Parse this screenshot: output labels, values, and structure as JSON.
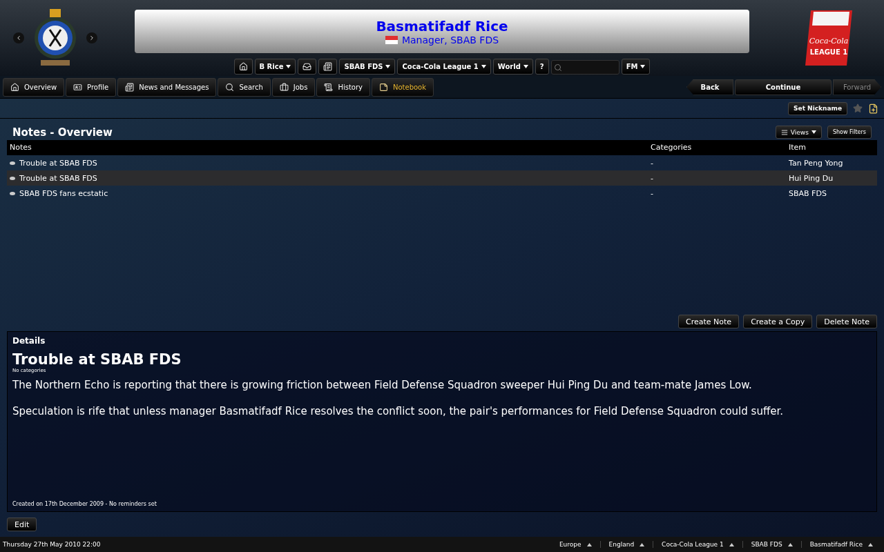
{
  "header": {
    "title": "Basmatifadf Rice",
    "subtitle": "Manager, SBAB FDS",
    "league_logo": [
      "Coca-Cola",
      "LEAGUE 1"
    ]
  },
  "toolbar": [
    {
      "kind": "home"
    },
    {
      "kind": "dropdown",
      "label": "B Rice"
    },
    {
      "kind": "inbox"
    },
    {
      "kind": "news"
    },
    {
      "kind": "dropdown",
      "label": "SBAB FDS"
    },
    {
      "kind": "dropdown",
      "label": "Coca-Cola League 1"
    },
    {
      "kind": "dropdown",
      "label": "World"
    },
    {
      "kind": "text",
      "label": "?"
    },
    {
      "kind": "search"
    },
    {
      "kind": "dropdown",
      "label": "FM"
    }
  ],
  "tabs": [
    {
      "label": "Overview",
      "selected": false
    },
    {
      "label": "Profile",
      "selected": false
    },
    {
      "label": "News and Messages",
      "selected": false
    },
    {
      "label": "Search",
      "selected": false
    },
    {
      "label": "Jobs",
      "selected": false
    },
    {
      "label": "History",
      "selected": false
    },
    {
      "label": "Notebook",
      "selected": true
    }
  ],
  "navigation": {
    "back": "Back",
    "continue": "Continue",
    "forward": "Forward",
    "forward_disabled": true
  },
  "nickname_button": "Set Nickname",
  "page_title": "Notes - Overview",
  "views_button": "Views",
  "filters_button": "Show Filters",
  "table": {
    "columns": [
      "Notes",
      "Categories",
      "Item"
    ],
    "rows": [
      {
        "note": "Trouble at SBAB FDS",
        "categories": "-",
        "item": "Tan Peng Yong",
        "selected": false
      },
      {
        "note": "Trouble at SBAB FDS",
        "categories": "-",
        "item": "Hui Ping Du",
        "selected": true
      },
      {
        "note": "SBAB FDS fans ecstatic",
        "categories": "-",
        "item": "SBAB FDS",
        "selected": false
      }
    ]
  },
  "actions": [
    "Create Note",
    "Create a Copy",
    "Delete Note"
  ],
  "details": {
    "heading": "Details",
    "title": "Trouble at SBAB FDS",
    "categories": "No categories",
    "paragraphs": [
      "The Northern Echo is reporting that there is growing friction between Field Defense Squadron sweeper Hui Ping Du and team-mate James Low.",
      "Speculation is rife that unless manager Basmatifadf Rice resolves the conflict soon, the pair's performances for Field Defense Squadron could suffer."
    ],
    "footer": "Created on 17th December 2009 - No reminders set"
  },
  "edit_button": "Edit",
  "status_bar": {
    "date": "Thursday 27th May 2010 22:00",
    "breadcrumbs": [
      "Europe",
      "England",
      "Coca-Cola League 1",
      "SBAB FDS",
      "Basmatifadf Rice"
    ]
  }
}
